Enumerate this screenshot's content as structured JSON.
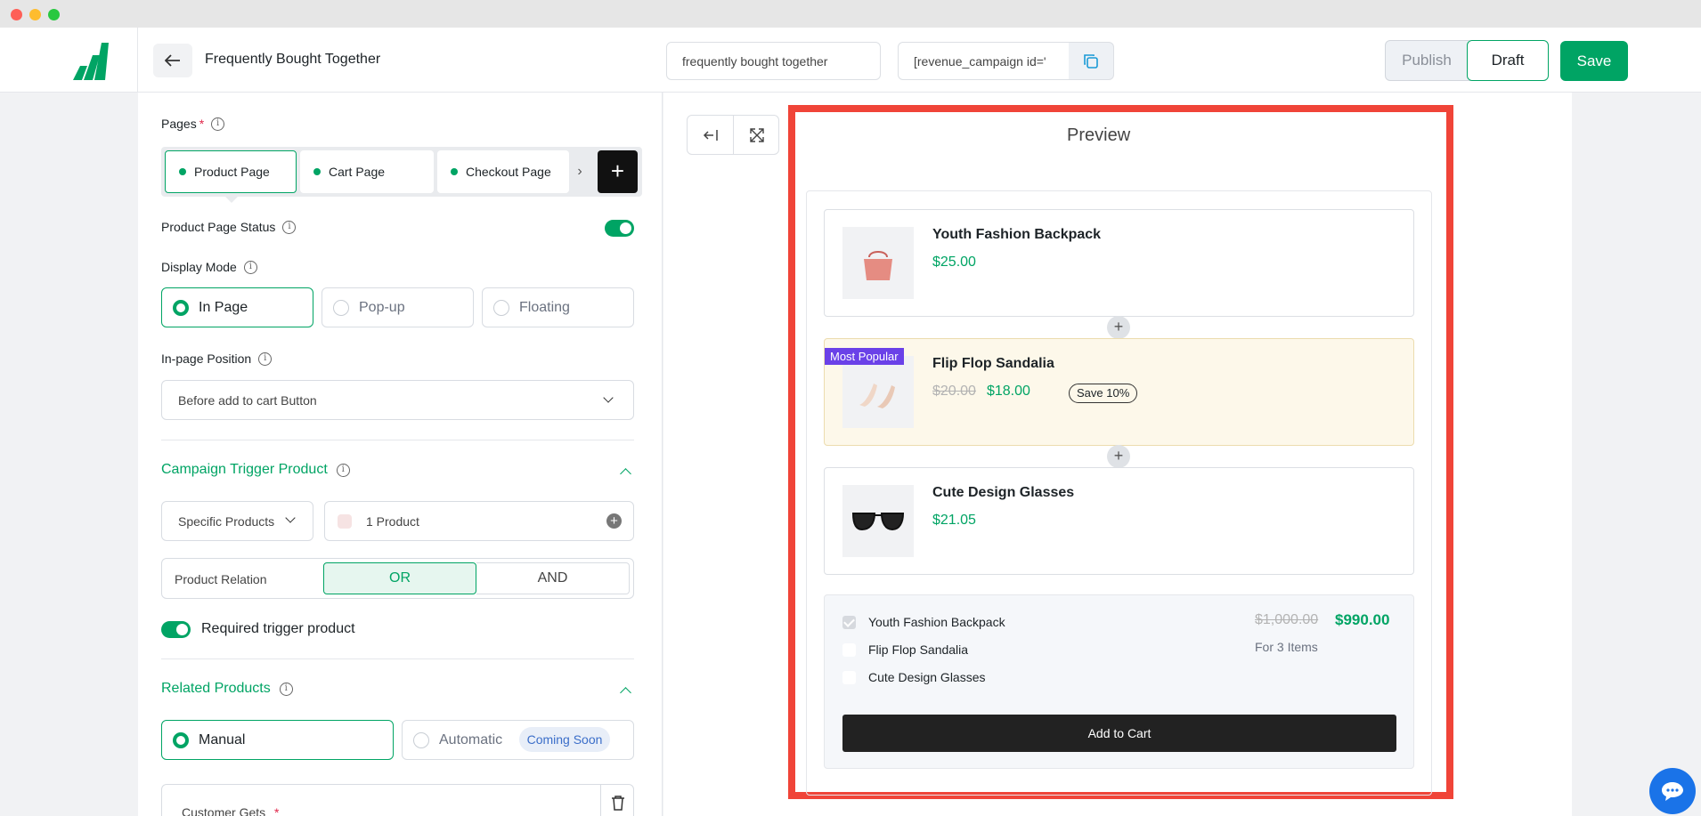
{
  "header": {
    "title": "Frequently Bought Together",
    "campaign_name": "frequently bought together",
    "shortcode": "[revenue_campaign id='",
    "publish_label": "Publish",
    "draft_label": "Draft",
    "save_label": "Save"
  },
  "left": {
    "pages_label": "Pages",
    "required_mark": "*",
    "page_tabs": [
      "Product Page",
      "Cart Page",
      "Checkout Page"
    ],
    "page_status_label": "Product Page Status",
    "display_mode_label": "Display Mode",
    "display_modes": [
      "In Page",
      "Pop-up",
      "Floating"
    ],
    "position_label": "In-page Position",
    "position_value": "Before add to cart Button",
    "trigger_title": "Campaign Trigger Product",
    "trigger_type": "Specific Products",
    "trigger_products": "1 Product",
    "relation_label": "Product Relation",
    "relation_or": "OR",
    "relation_and": "AND",
    "required_trigger_label": "Required trigger product",
    "related_title": "Related Products",
    "related_manual": "Manual",
    "related_auto": "Automatic",
    "coming_soon": "Coming Soon",
    "customer_gets_label": "Customer Gets"
  },
  "preview": {
    "title": "Preview",
    "products": [
      {
        "name": "Youth Fashion Backpack",
        "price": "$25.00"
      },
      {
        "name": "Flip Flop Sandalia",
        "old_price": "$20.00",
        "price": "$18.00",
        "badge": "Most Popular",
        "save": "Save 10%"
      },
      {
        "name": "Cute Design Glasses",
        "price": "$21.05"
      }
    ],
    "summary": {
      "items": [
        "Youth Fashion Backpack",
        "Flip Flop Sandalia",
        "Cute Design Glasses"
      ],
      "old_total": "$1,000.00",
      "total": "$990.00",
      "note": "For 3 Items",
      "button": "Add to Cart"
    }
  },
  "colors": {
    "accent": "#00a464",
    "highlight": "#f04438",
    "badge": "#6a41e8"
  },
  "icons": [
    "arrow-left-icon",
    "copy-icon",
    "info-icon",
    "plus-icon",
    "chevron-down-icon",
    "chevron-up-icon",
    "collapse-left-icon",
    "expand-icon",
    "trash-icon",
    "chat-icon"
  ]
}
